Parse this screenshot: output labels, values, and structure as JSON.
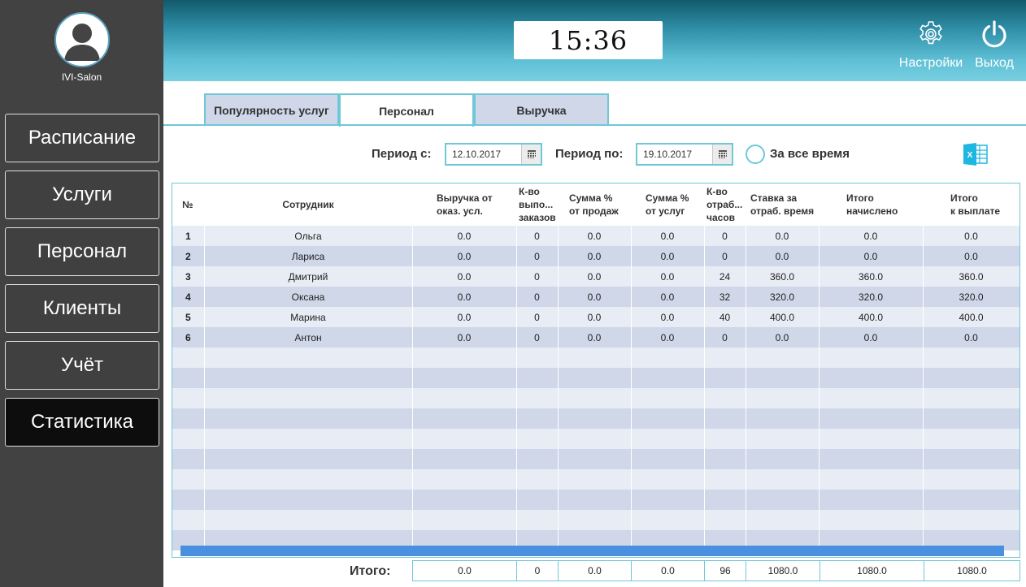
{
  "sidebar": {
    "salon_name": "IVI-Salon",
    "nav": [
      {
        "label": "Расписание"
      },
      {
        "label": "Услуги"
      },
      {
        "label": "Персонал"
      },
      {
        "label": "Клиенты"
      },
      {
        "label": "Учёт"
      },
      {
        "label": "Статистика",
        "active": true
      }
    ]
  },
  "header": {
    "clock": "15:36",
    "settings_label": "Настройки",
    "exit_label": "Выход"
  },
  "tabs": [
    {
      "label": "Популярность услуг"
    },
    {
      "label": "Персонал",
      "active": true
    },
    {
      "label": "Выручка"
    }
  ],
  "filters": {
    "from_label": "Период с:",
    "from_value": "12.10.2017",
    "to_label": "Период по:",
    "to_value": "19.10.2017",
    "all_time_label": "За все время",
    "all_time_checked": false
  },
  "table": {
    "columns": [
      "№",
      "Сотрудник",
      "Выручка от\nоказ. усл.",
      "К-во\nвыпо...\nзаказов",
      "Сумма %\nот продаж",
      "Сумма %\nот услуг",
      "К-во\nотраб...\nчасов",
      "Ставка за\nотраб. время",
      "Итого\nначислено",
      "Итого\nк выплате"
    ],
    "rows": [
      [
        "1",
        "Ольга",
        "0.0",
        "0",
        "0.0",
        "0.0",
        "0",
        "0.0",
        "0.0",
        "0.0"
      ],
      [
        "2",
        "Лариса",
        "0.0",
        "0",
        "0.0",
        "0.0",
        "0",
        "0.0",
        "0.0",
        "0.0"
      ],
      [
        "3",
        "Дмитрий",
        "0.0",
        "0",
        "0.0",
        "0.0",
        "24",
        "360.0",
        "360.0",
        "360.0"
      ],
      [
        "4",
        "Оксана",
        "0.0",
        "0",
        "0.0",
        "0.0",
        "32",
        "320.0",
        "320.0",
        "320.0"
      ],
      [
        "5",
        "Марина",
        "0.0",
        "0",
        "0.0",
        "0.0",
        "40",
        "400.0",
        "400.0",
        "400.0"
      ],
      [
        "6",
        "Антон",
        "0.0",
        "0",
        "0.0",
        "0.0",
        "0",
        "0.0",
        "0.0",
        "0.0"
      ]
    ]
  },
  "totals": {
    "label": "Итого:",
    "values": [
      "0.0",
      "0",
      "0.0",
      "0.0",
      "96",
      "1080.0",
      "1080.0",
      "1080.0"
    ]
  },
  "colors": {
    "accent": "#6fc8d8",
    "sidebar_bg": "#424242",
    "row_odd": "#e8edf5",
    "row_even": "#cfd7e8",
    "scrollbar": "#4a8fe0"
  },
  "icons": {
    "avatar": "user-avatar-icon",
    "settings": "gear-icon",
    "exit": "power-icon",
    "calendar": "calendar-icon",
    "export": "excel-icon"
  }
}
